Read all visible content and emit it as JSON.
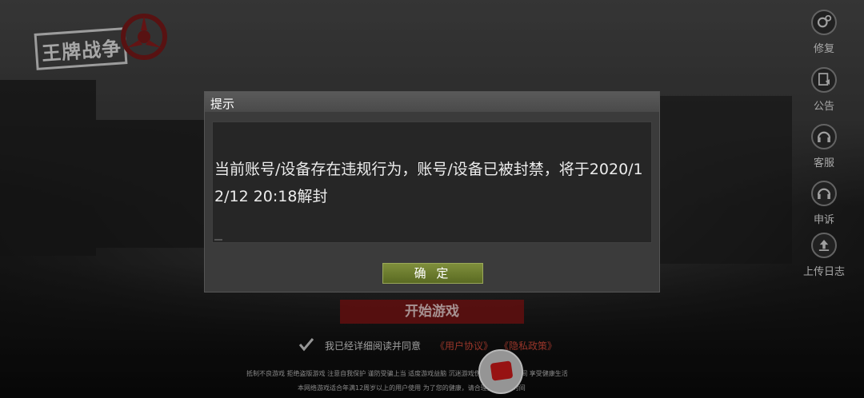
{
  "game": {
    "logo_text": "王牌战争"
  },
  "side_menu": [
    {
      "label": "修复",
      "icon": "gear-icon"
    },
    {
      "label": "公告",
      "icon": "notice-icon"
    },
    {
      "label": "客服",
      "icon": "headset-icon"
    },
    {
      "label": "申诉",
      "icon": "headset-appeal-icon"
    },
    {
      "label": "上传日志",
      "icon": "upload-icon"
    }
  ],
  "start_button": "开始游戏",
  "agreement": {
    "text": "我已经详细阅读并同意",
    "user_agreement": "《用户协议》",
    "privacy_policy": "《隐私政策》"
  },
  "fine_print": {
    "line1": "抵制不良游戏 拒绝盗版游戏 注意自我保护 谨防受骗上当 适度游戏益脑 沉迷游戏伤身 合理安排时间 享受健康生活",
    "line2": "本网络游戏适合年满12周岁以上的用户使用   为了您的健康，请合理控制游戏时间"
  },
  "dialog": {
    "title": "提示",
    "message": "当前账号/设备存在违规行为，账号/设备已被封禁，将于2020/12/12 20:18解封",
    "confirm": "确 定"
  },
  "colors": {
    "accent_red": "#d24a3a",
    "confirm_green": "#6f7f30",
    "start_red": "#961414"
  }
}
